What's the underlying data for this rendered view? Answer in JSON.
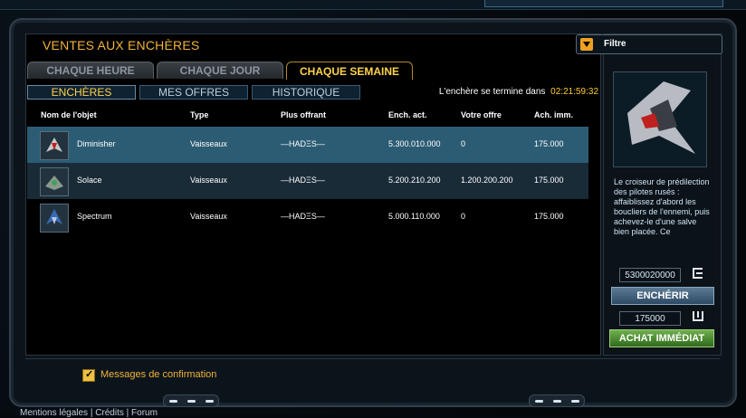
{
  "page_title": "VENTES AUX ENCHÈRES",
  "filter": {
    "label": "Filtre"
  },
  "tabs": [
    {
      "label": "CHAQUE HEURE",
      "active": false
    },
    {
      "label": "CHAQUE JOUR",
      "active": false
    },
    {
      "label": "CHAQUE SEMAINE",
      "active": true
    }
  ],
  "subtabs": [
    {
      "label": "ENCHÈRES",
      "active": true
    },
    {
      "label": "MES OFFRES",
      "active": false
    },
    {
      "label": "HISTORIQUE",
      "active": false
    }
  ],
  "timer": {
    "label": "L'enchère se termine dans",
    "value": "02:21:59:32"
  },
  "table": {
    "columns": [
      "Nom de l'objet",
      "Type",
      "Plus offrant",
      "Ench. act.",
      "Votre offre",
      "Ach. imm."
    ],
    "rows": [
      {
        "icon": "diminisher-ship-icon",
        "name": "Diminisher",
        "type": "Vaisseaux",
        "bidder": "—HADΞS—",
        "current": "5.300.010.000",
        "yours": "0",
        "buyout": "175.000"
      },
      {
        "icon": "solace-ship-icon",
        "name": "Solace",
        "type": "Vaisseaux",
        "bidder": "—HADΞS—",
        "current": "5.200.210.200",
        "yours": "1.200.200.200",
        "buyout": "175.000"
      },
      {
        "icon": "spectrum-ship-icon",
        "name": "Spectrum",
        "type": "Vaisseaux",
        "bidder": "—HADΞS—",
        "current": "5.000.110.000",
        "yours": "0",
        "buyout": "175.000"
      }
    ]
  },
  "details": {
    "description": "Le croiseur de prédilection des pilotes rusés : affaiblissez d'abord les boucliers de l'ennemi, puis achevez-le d'une salve bien placée. Ce",
    "bid_value": "5300020000",
    "bid_button": "ENCHÉRIR",
    "buyout_value": "175000",
    "buyout_button": "ACHAT IMMÉDIAT"
  },
  "confirmation": {
    "label": "Messages de confirmation",
    "checked": true
  },
  "footer": "Mentions légales | Crédits | Forum",
  "colors": {
    "accent": "#f0b23a",
    "selected_row": "#2c5c74",
    "buy_button": "#4a8a2c",
    "bid_button": "#3c5a74"
  }
}
